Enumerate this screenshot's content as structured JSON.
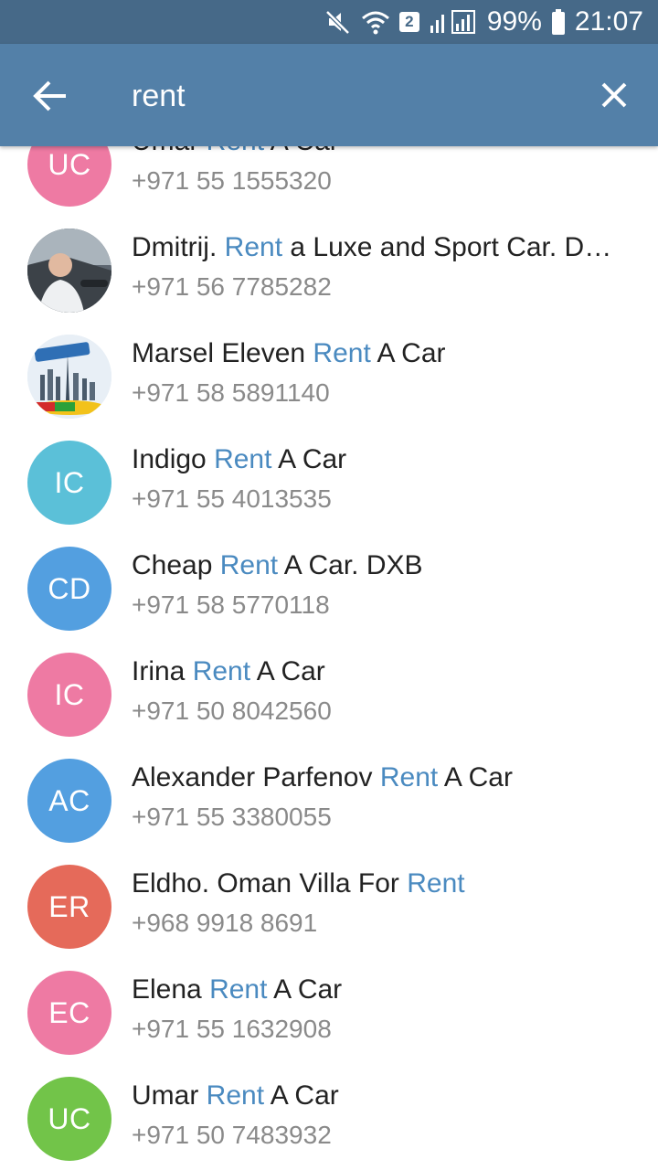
{
  "status_bar": {
    "battery": "99%",
    "time": "21:07",
    "sim_slot": "2"
  },
  "search": {
    "query": "rent"
  },
  "results": [
    {
      "initials": "UC",
      "color": "#ee7aa3",
      "photo": null,
      "name_before": "Umar ",
      "highlight": "Rent",
      "name_after": " A Car",
      "phone": "+971 55 1555320"
    },
    {
      "initials": "",
      "color": "#7c8a96",
      "photo": "man-in-car-photo",
      "name_before": "Dmitrij. ",
      "highlight": "Rent",
      "name_after": " a Luxe and Sport Car. Dubai",
      "phone": "+971 56 7785282"
    },
    {
      "initials": "",
      "color": "#dfeaf5",
      "photo": "vip-dxb-logo",
      "name_before": "Marsel Eleven ",
      "highlight": "Rent",
      "name_after": " A Car",
      "phone": "+971 58 5891140"
    },
    {
      "initials": "IC",
      "color": "#5bc0d8",
      "photo": null,
      "name_before": "Indigo ",
      "highlight": "Rent",
      "name_after": " A Car",
      "phone": "+971 55 4013535"
    },
    {
      "initials": "CD",
      "color": "#539fe0",
      "photo": null,
      "name_before": "Cheap ",
      "highlight": "Rent",
      "name_after": " A Car. DXB",
      "phone": "+971 58 5770118"
    },
    {
      "initials": "IC",
      "color": "#ee7aa3",
      "photo": null,
      "name_before": "Irina ",
      "highlight": "Rent",
      "name_after": " A Car",
      "phone": "+971 50 8042560"
    },
    {
      "initials": "AC",
      "color": "#539fe0",
      "photo": null,
      "name_before": "Alexander Parfenov ",
      "highlight": "Rent",
      "name_after": " A Car",
      "phone": "+971 55 3380055"
    },
    {
      "initials": "ER",
      "color": "#e56a5a",
      "photo": null,
      "name_before": "Eldho. Oman Villa For ",
      "highlight": "Rent",
      "name_after": "",
      "phone": "+968 9918 8691"
    },
    {
      "initials": "EC",
      "color": "#ee7aa3",
      "photo": null,
      "name_before": "Elena ",
      "highlight": "Rent",
      "name_after": " A Car",
      "phone": "+971 55 1632908"
    },
    {
      "initials": "UC",
      "color": "#72c449",
      "photo": null,
      "name_before": "Umar ",
      "highlight": "Rent",
      "name_after": " A Car",
      "phone": "+971 50 7483932"
    }
  ]
}
